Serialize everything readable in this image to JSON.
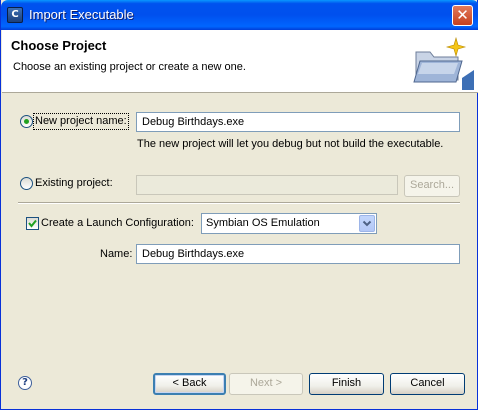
{
  "window": {
    "title": "Import Executable",
    "app_icon_letter": "C",
    "close_glyph": "✕"
  },
  "header": {
    "title": "Choose Project",
    "description": "Choose an existing project or create a new one.",
    "graphic_icon": "folder-sparkle-icon"
  },
  "new_project": {
    "label": "New project name:",
    "value": "Debug Birthdays.exe",
    "selected": true,
    "hint": "The new project will let you debug but not build the executable."
  },
  "existing_project": {
    "label": "Existing project:",
    "value": "",
    "selected": false,
    "search_label": "Search..."
  },
  "launch_config": {
    "checkbox_label": "Create a Launch Configuration:",
    "checked": true,
    "selected_option": "Symbian OS Emulation",
    "name_label": "Name:",
    "name_value": "Debug Birthdays.exe"
  },
  "buttons": {
    "back": "< Back",
    "next": "Next >",
    "finish": "Finish",
    "cancel": "Cancel"
  },
  "help_icon": "help-icon",
  "colors": {
    "title_bar": "#0053ee",
    "dialog_bg": "#ece9d8",
    "radio_dot": "#21a121",
    "checkmark": "#21a121"
  }
}
